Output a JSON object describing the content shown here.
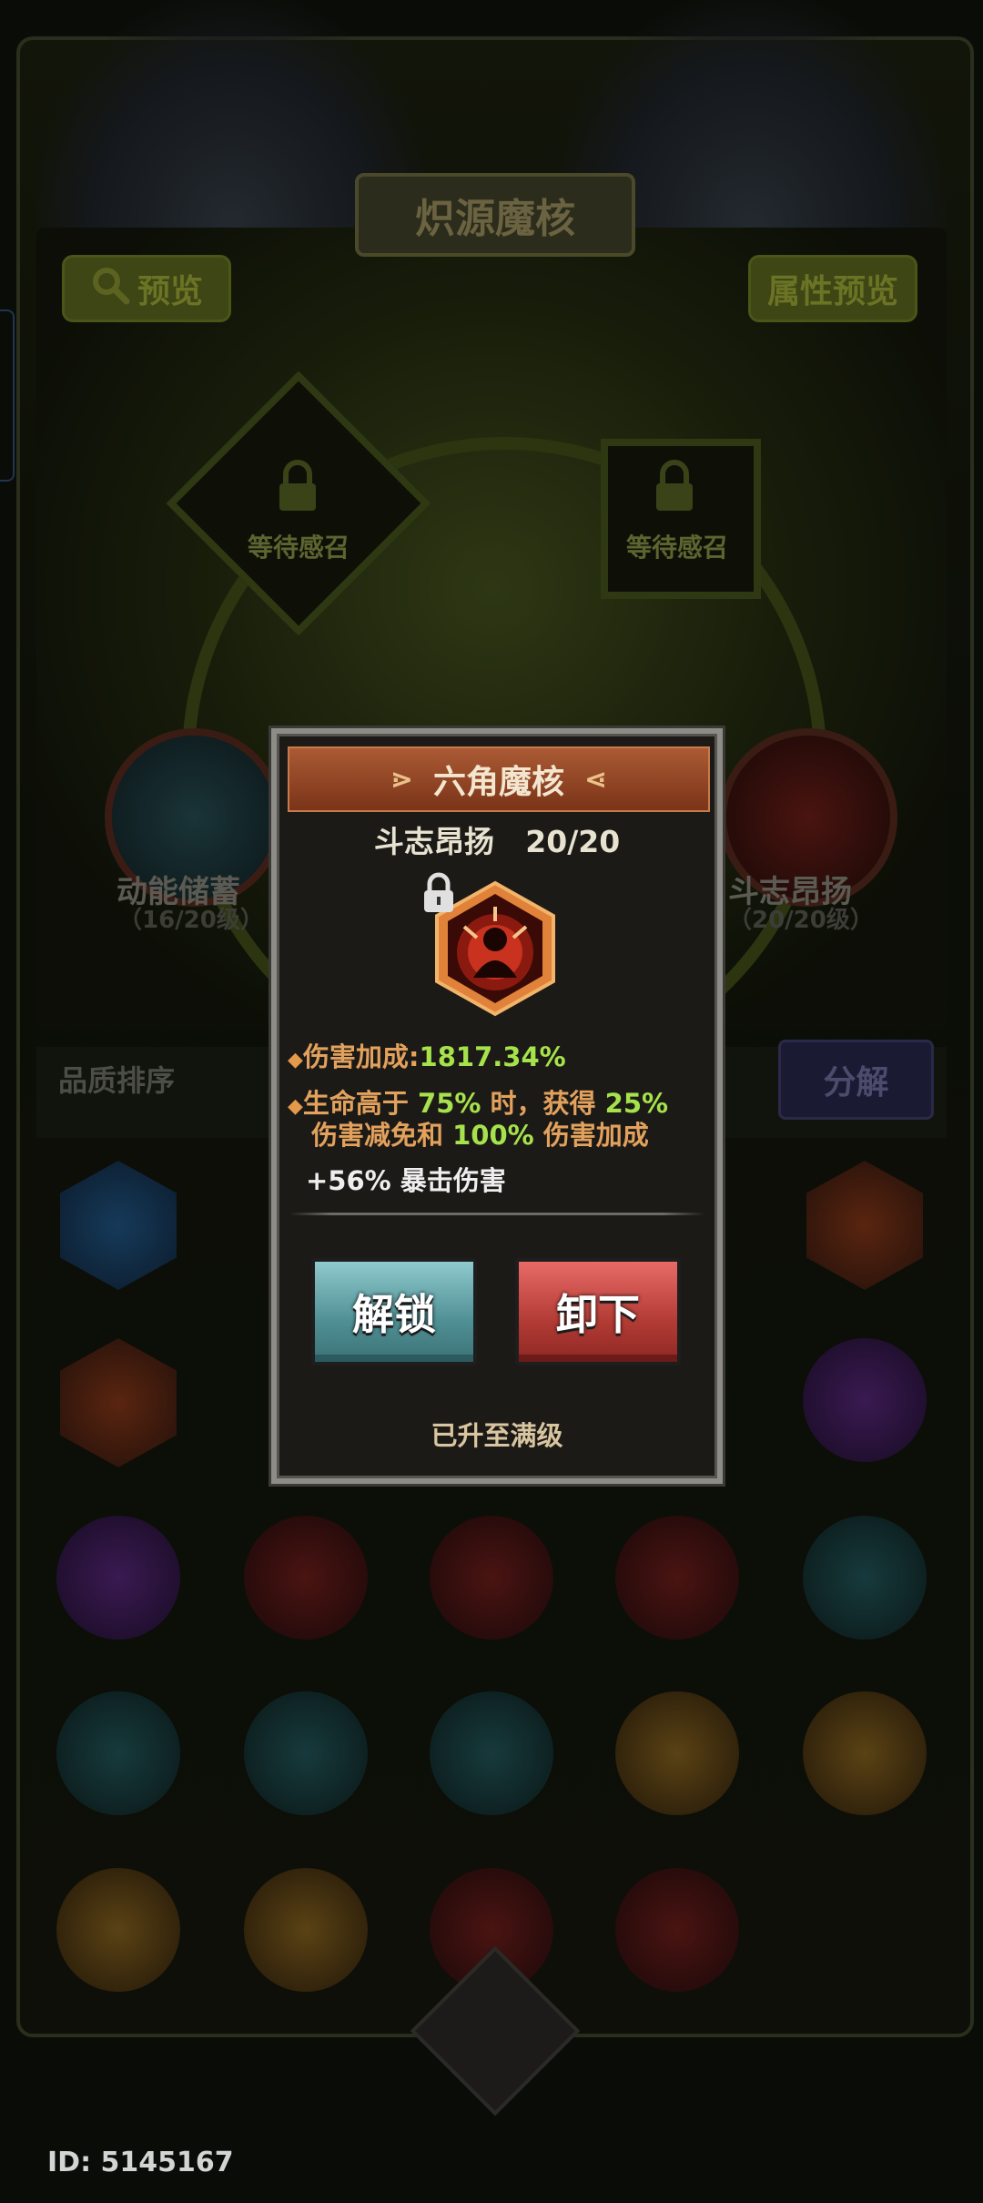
{
  "background": {
    "title": "炽源魔核",
    "preview_label": "预览",
    "attr_preview_label": "属性预览",
    "slot_left_label": "等待感召",
    "slot_right_label": "等待感召",
    "side_left": {
      "name": "动能储蓄",
      "level": "（16/20级）"
    },
    "side_right": {
      "name": "斗志昂扬",
      "level": "（20/20级）"
    },
    "sort_label": "品质排序",
    "decompose_label": "分解",
    "id_text": "ID: 5145167"
  },
  "popup": {
    "title": "六角魔核",
    "core_name": "斗志昂扬",
    "core_level": "20/20",
    "stats": {
      "damage_label": "伤害加成:",
      "damage_value": "1817.34%",
      "cond_prefix": "生命高于 ",
      "cond_threshold": "75%",
      "cond_mid": " 时，获得 ",
      "cond_reduce": "25%",
      "cond_line2_prefix": "伤害减免和 ",
      "cond_bonus": "100%",
      "cond_line2_suffix": " 伤害加成",
      "crit_line": "+56% 暴击伤害"
    },
    "buttons": {
      "unlock": "解锁",
      "unequip": "卸下"
    },
    "status": "已升至满级"
  },
  "colors": {
    "highlight_green": "#a6e24b",
    "stat_orange": "#e2a15c",
    "unlock_teal": "#4f8f94",
    "unequip_red": "#b23b35",
    "header_brown": "#9a4a28"
  }
}
